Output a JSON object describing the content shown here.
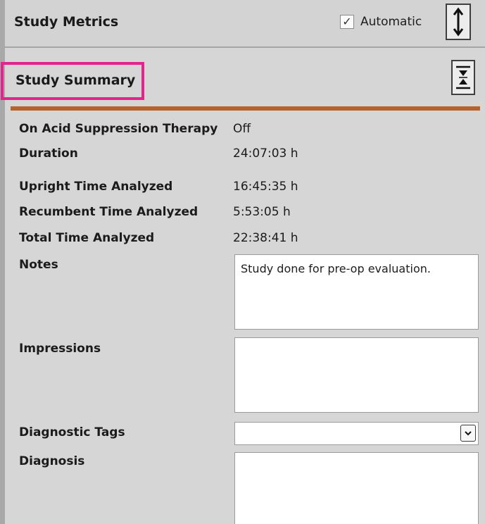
{
  "metrics": {
    "title": "Study Metrics",
    "automatic_label": "Automatic",
    "automatic_checked": true,
    "checkmark": "✓"
  },
  "summary": {
    "title": "Study Summary"
  },
  "fields": {
    "acid_therapy": {
      "label": "On Acid Suppression Therapy",
      "value": "Off"
    },
    "duration": {
      "label": "Duration",
      "value": "24:07:03 h"
    },
    "upright": {
      "label": "Upright Time Analyzed",
      "value": "16:45:35 h"
    },
    "recumbent": {
      "label": "Recumbent Time Analyzed",
      "value": "5:53:05 h"
    },
    "total": {
      "label": "Total Time Analyzed",
      "value": "22:38:41 h"
    },
    "notes": {
      "label": "Notes",
      "value": "Study done for pre-op evaluation."
    },
    "impressions": {
      "label": "Impressions",
      "value": ""
    },
    "diagnostic_tags": {
      "label": "Diagnostic Tags",
      "value": ""
    },
    "diagnosis": {
      "label": "Diagnosis",
      "value": ""
    }
  },
  "icons": {
    "expand": "expand-vertical-icon",
    "collapse": "collapse-vertical-icon",
    "dropdown": "chevron-down-icon"
  },
  "colors": {
    "highlight": "#e2258e",
    "accent_bar": "#b5632a",
    "panel_bg": "#d6d6d6"
  }
}
